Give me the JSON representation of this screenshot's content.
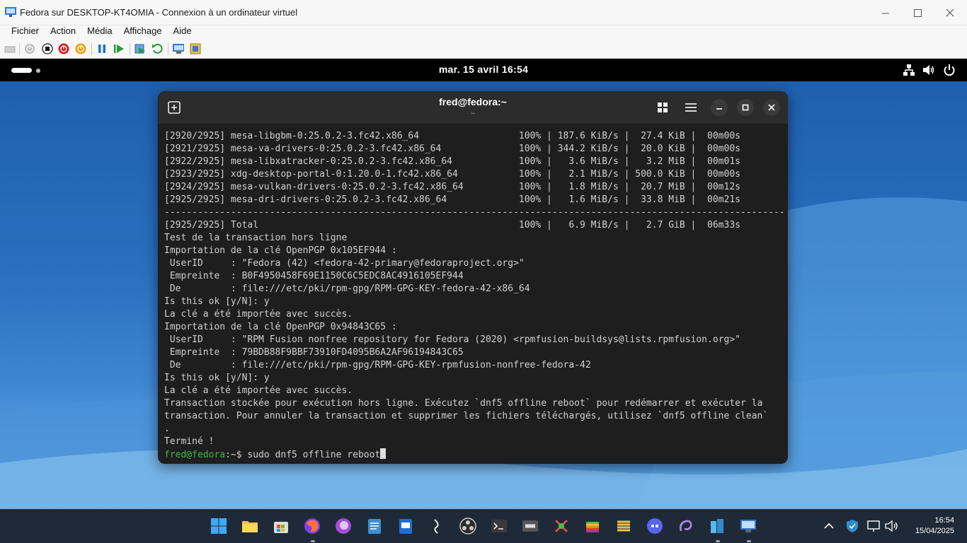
{
  "vm_window": {
    "title": "Fedora sur DESKTOP-KT4OMIA - Connexion à un ordinateur virtuel",
    "menu": [
      "Fichier",
      "Action",
      "Média",
      "Affichage",
      "Aide"
    ]
  },
  "gnome_bar": {
    "clock": "mar. 15 avril  16:54"
  },
  "terminal": {
    "title": "fred@fedora:~",
    "subtitle": "~",
    "lines": [
      "[2920/2925] mesa-libgbm-0:25.0.2-3.fc42.x86_64                  100% | 187.6 KiB/s |  27.4 KiB |  00m00s",
      "[2921/2925] mesa-va-drivers-0:25.0.2-3.fc42.x86_64              100% | 344.2 KiB/s |  20.0 KiB |  00m00s",
      "[2922/2925] mesa-libxatracker-0:25.0.2-3.fc42.x86_64            100% |   3.6 MiB/s |   3.2 MiB |  00m01s",
      "[2923/2925] xdg-desktop-portal-0:1.20.0-1.fc42.x86_64           100% |   2.1 MiB/s | 500.0 KiB |  00m00s",
      "[2924/2925] mesa-vulkan-drivers-0:25.0.2-3.fc42.x86_64          100% |   1.8 MiB/s |  20.7 MiB |  00m12s",
      "[2925/2925] mesa-dri-drivers-0:25.0.2-3.fc42.x86_64             100% |   1.6 MiB/s |  33.8 MiB |  00m21s",
      "-------------------------------------------------------------------------------------------------------------------",
      "[2925/2925] Total                                               100% |   6.9 MiB/s |   2.7 GiB |  06m33s",
      "Test de la transaction hors ligne",
      "Importation de la clé OpenPGP 0x105EF944 :",
      " UserID     : \"Fedora (42) <fedora-42-primary@fedoraproject.org>\"",
      " Empreinte  : B0F4950458F69E1150C6C5EDC8AC4916105EF944",
      " De         : file:///etc/pki/rpm-gpg/RPM-GPG-KEY-fedora-42-x86_64",
      "Is this ok [y/N]: y",
      "La clé a été importée avec succès.",
      "Importation de la clé OpenPGP 0x94843C65 :",
      " UserID     : \"RPM Fusion nonfree repository for Fedora (2020) <rpmfusion-buildsys@lists.rpmfusion.org>\"",
      " Empreinte  : 79BDB88F9BBF73910FD4095B6A2AF96194843C65",
      " De         : file:///etc/pki/rpm-gpg/RPM-GPG-KEY-rpmfusion-nonfree-fedora-42",
      "Is this ok [y/N]: y",
      "La clé a été importée avec succès.",
      "Transaction stockée pour exécution hors ligne. Exécutez `dnf5 offline reboot` pour redémarrer et exécuter la",
      "transaction. Pour annuler la transaction et supprimer les fichiers téléchargés, utilisez `dnf5 offline clean`",
      ".",
      "Terminé !"
    ],
    "prompt": {
      "user_host": "fred@fedora",
      "path": ":~$ ",
      "command": "sudo dnf5 offline reboot"
    }
  },
  "taskbar": {
    "time": "16:54",
    "date": "15/04/2025"
  }
}
